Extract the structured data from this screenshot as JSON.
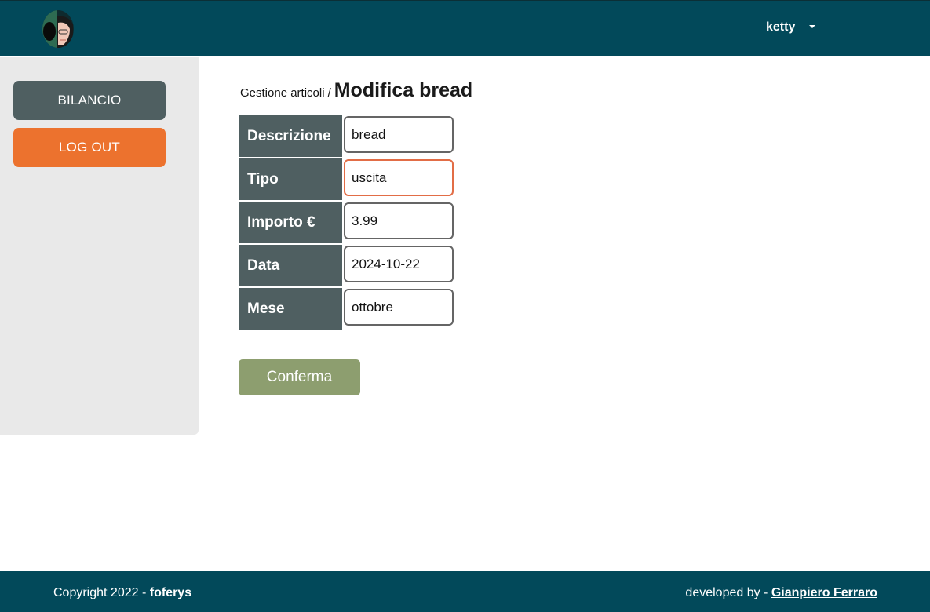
{
  "header": {
    "user_name": "ketty",
    "brand_color": "#02495a"
  },
  "sidebar": {
    "items": [
      {
        "label": "BILANCIO",
        "color": "#4f5f61"
      },
      {
        "label": "LOG OUT",
        "color": "#ec722e"
      }
    ]
  },
  "breadcrumb": {
    "parent": "Gestione articoli",
    "separator": "/",
    "title": "Modifica bread"
  },
  "form": {
    "fields": [
      {
        "label": "Descrizione",
        "value": "bread"
      },
      {
        "label": "Tipo",
        "value": "uscita",
        "focused": true
      },
      {
        "label": "Importo €",
        "value": "3.99"
      },
      {
        "label": "Data",
        "value": "2024-10-22"
      },
      {
        "label": "Mese",
        "value": "ottobre"
      }
    ],
    "submit_label": "Conferma",
    "submit_color": "#8d9e6f"
  },
  "footer": {
    "copyright_prefix": "Copyright 2022 -",
    "copyright_brand": "foferys",
    "developed_prefix": "developed by -",
    "developer_name": "Gianpiero Ferraro"
  }
}
